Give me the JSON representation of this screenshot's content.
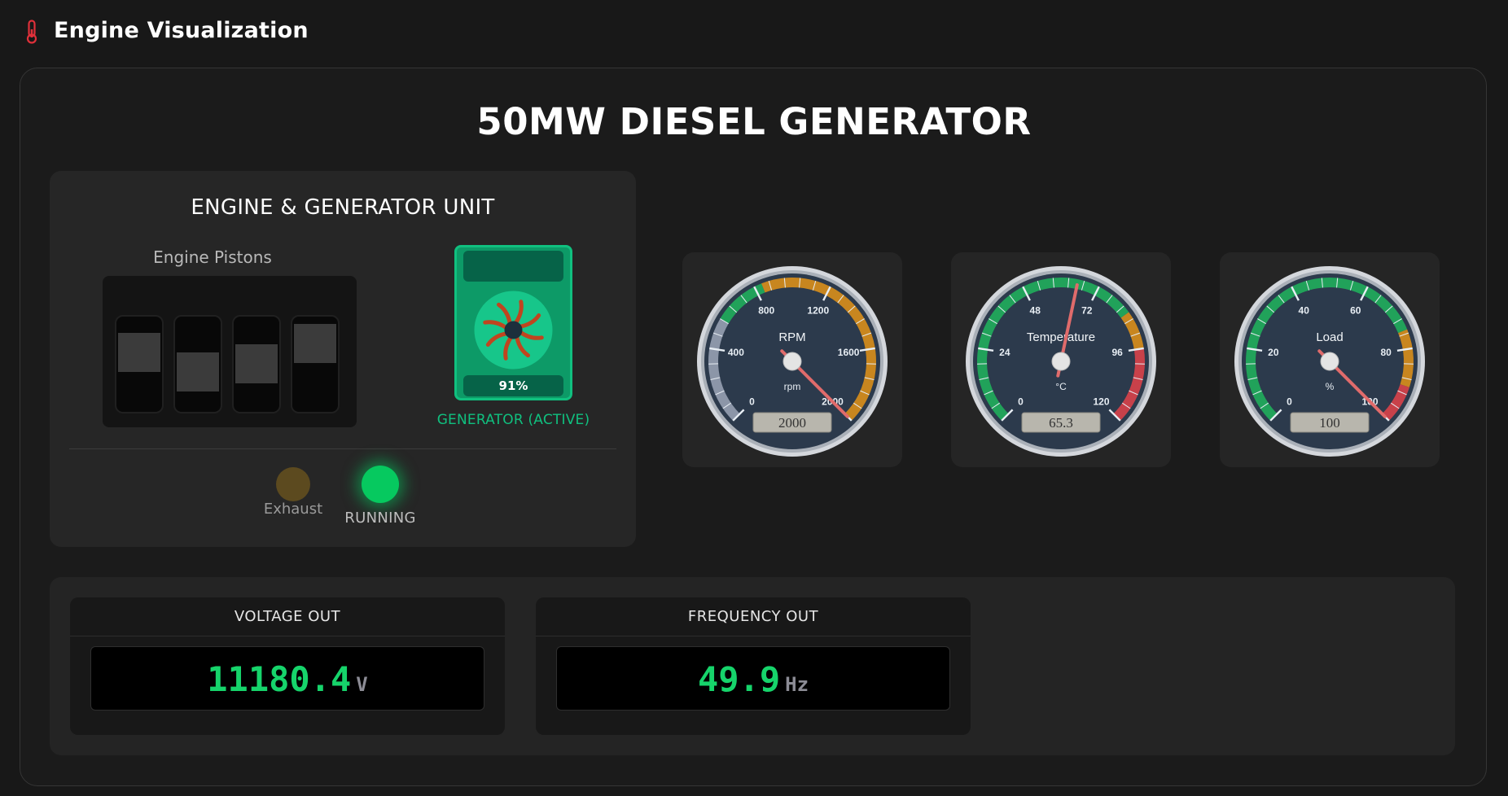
{
  "app": {
    "title": "Engine Visualization",
    "icon": "thermometer-icon",
    "accent_color": "#e0303a"
  },
  "page": {
    "title": "50MW DIESEL GENERATOR"
  },
  "unit": {
    "title": "ENGINE & GENERATOR UNIT",
    "pistons_label": "Engine Pistons",
    "piston_positions": [
      0.2,
      0.55,
      0.4,
      0.05
    ],
    "generator": {
      "load_text": "91%",
      "label": "GENERATOR (ACTIVE)",
      "color": "#0d9a67"
    },
    "indicators": {
      "exhaust_label": "Exhaust",
      "exhaust_on": false,
      "running_label": "RUNNING",
      "running_on": true
    }
  },
  "gauges": [
    {
      "label": "RPM",
      "unit": "rpm",
      "min": 0,
      "max": 2000,
      "value": 2000,
      "display": "2000",
      "ticks": [
        "0",
        "400",
        "800",
        "1200",
        "1600",
        "2000"
      ],
      "bands": [
        {
          "from": 0,
          "to": 560,
          "color": "#8c96a8"
        },
        {
          "from": 560,
          "to": 840,
          "color": "#21a25a"
        },
        {
          "from": 840,
          "to": 2000,
          "color": "#c8861f"
        }
      ]
    },
    {
      "label": "Temperature",
      "unit": "°C",
      "min": 0,
      "max": 120,
      "value": 65.3,
      "display": "65.3",
      "ticks": [
        "0",
        "24",
        "48",
        "72",
        "96",
        "120"
      ],
      "bands": [
        {
          "from": 0,
          "to": 84,
          "color": "#21a25a"
        },
        {
          "from": 84,
          "to": 96,
          "color": "#c8861f"
        },
        {
          "from": 96,
          "to": 120,
          "color": "#c8414a"
        }
      ]
    },
    {
      "label": "Load",
      "unit": "%",
      "min": 0,
      "max": 100,
      "value": 100,
      "display": "100",
      "ticks": [
        "0",
        "20",
        "40",
        "60",
        "80",
        "100"
      ],
      "bands": [
        {
          "from": 0,
          "to": 75,
          "color": "#21a25a"
        },
        {
          "from": 75,
          "to": 90,
          "color": "#c8861f"
        },
        {
          "from": 90,
          "to": 100,
          "color": "#c8414a"
        }
      ]
    }
  ],
  "readouts": [
    {
      "title": "VOLTAGE OUT",
      "value": "11180.4",
      "unit": "V"
    },
    {
      "title": "FREQUENCY OUT",
      "value": "49.9",
      "unit": "Hz"
    }
  ]
}
